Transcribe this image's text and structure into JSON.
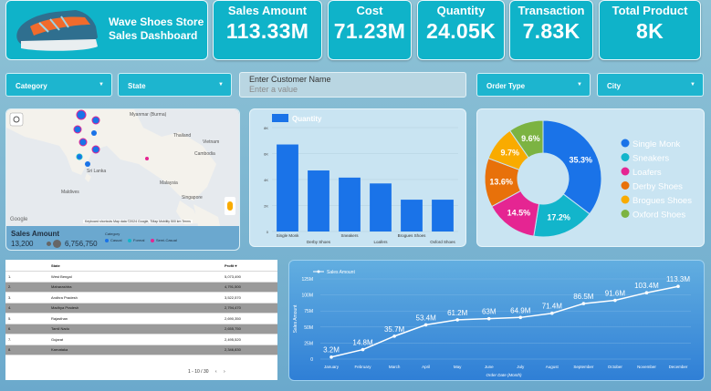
{
  "header": {
    "title_line1": "Wave Shoes Store",
    "title_line2": "Sales Dashboard"
  },
  "kpis": [
    {
      "label": "Sales Amount",
      "value": "113.33M"
    },
    {
      "label": "Cost",
      "value": "71.23M"
    },
    {
      "label": "Quantity",
      "value": "24.05K"
    },
    {
      "label": "Transaction",
      "value": "7.83K"
    },
    {
      "label": "Total Product",
      "value": "8K"
    }
  ],
  "filters": {
    "category": "Category",
    "state": "State",
    "customer_label": "Enter Customer Name",
    "customer_placeholder": "Enter a value",
    "order_type": "Order Type",
    "city": "City"
  },
  "map": {
    "places": [
      "Myanmar (Burma)",
      "Thailand",
      "Vietnam",
      "Cambodia",
      "Sri Lanka",
      "Maldives",
      "Malaysia",
      "Singapore"
    ],
    "google": "Google",
    "attribution": "Keyboard shortcuts   Map data ©2024 Google, TMap Mobility   500 km   Terms",
    "legend_title": "Sales Amount",
    "legend_min": "13,200",
    "legend_max": "6,756,750",
    "category_label": "Category",
    "categories": [
      "Casual",
      "Formal",
      "Semi-Casual"
    ],
    "category_colors": [
      "#1a73e8",
      "#12b5cb",
      "#e52592"
    ]
  },
  "table": {
    "headers": [
      "",
      "State",
      "Profit ▾"
    ],
    "rows": [
      [
        "1.",
        "West Bengal",
        "5,073,490"
      ],
      [
        "2.",
        "Maharashtra",
        "4,791,500"
      ],
      [
        "3.",
        "Andhra Pradesh",
        "3,522,570"
      ],
      [
        "4.",
        "Madhya Pradesh",
        "2,794,470"
      ],
      [
        "5.",
        "Rajasthan",
        "2,690,350"
      ],
      [
        "6.",
        "Tamil Nadu",
        "2,655,750"
      ],
      [
        "7.",
        "Gujarat",
        "2,495,520"
      ],
      [
        "8.",
        "Karnataka",
        "2,346,830"
      ]
    ],
    "pager": "1 - 10 / 30"
  },
  "chart_data": [
    {
      "type": "bar",
      "title": "",
      "legend": "Quantity",
      "categories": [
        "Single Monk",
        "Derby Shoes",
        "Sneakers",
        "Loafers",
        "Brogues Shoes",
        "Oxford Shoes"
      ],
      "values": [
        6700,
        4700,
        4150,
        3700,
        2450,
        2450
      ],
      "yticks": [
        "0",
        "2K",
        "4K",
        "6K",
        "8K"
      ],
      "ylim": [
        0,
        8000
      ],
      "color": "#1a73e8"
    },
    {
      "type": "pie",
      "labels": [
        "Single Monk",
        "Sneakers",
        "Loafers",
        "Derby Shoes",
        "Brogues Shoes",
        "Oxford Shoes"
      ],
      "values": [
        35.3,
        17.2,
        14.5,
        13.6,
        9.7,
        9.6
      ],
      "value_labels": [
        "35.3%",
        "17.2%",
        "14.5%",
        "13.6%",
        "9.7%",
        "9.6%"
      ],
      "colors": [
        "#1a73e8",
        "#12b5cb",
        "#e52592",
        "#e8710a",
        "#f9ab00",
        "#7cb342"
      ]
    },
    {
      "type": "line",
      "legend": "Sales Amount",
      "xlabel": "Order Date (Month)",
      "ylabel": "Sales Amount",
      "categories": [
        "January",
        "February",
        "March",
        "April",
        "May",
        "June",
        "July",
        "August",
        "September",
        "October",
        "November",
        "December"
      ],
      "values": [
        3.2,
        14.8,
        35.7,
        53.4,
        61.2,
        63.0,
        64.9,
        71.4,
        86.5,
        91.6,
        103.4,
        113.3
      ],
      "value_labels": [
        "3.2M",
        "14.8M",
        "35.7M",
        "53.4M",
        "61.2M",
        "63M",
        "64.9M",
        "71.4M",
        "86.5M",
        "91.6M",
        "103.4M",
        "113.3M"
      ],
      "yticks": [
        "0",
        "25M",
        "50M",
        "75M",
        "100M",
        "125M"
      ],
      "ylim": [
        0,
        125
      ]
    }
  ]
}
